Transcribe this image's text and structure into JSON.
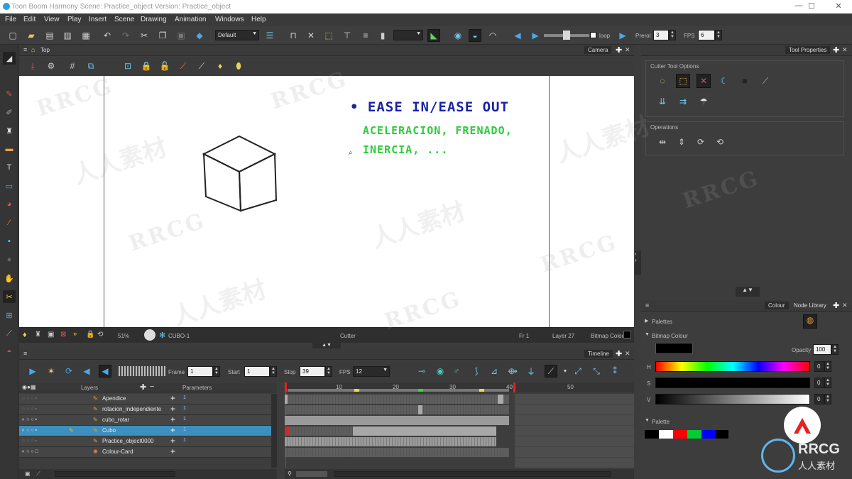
{
  "window": {
    "title": "Toon Boom Harmony Scene: Practice_object Version: Practice_object",
    "minimize": "—",
    "maximize": "☐",
    "close": "✕"
  },
  "menu": [
    "File",
    "Edit",
    "View",
    "Play",
    "Insert",
    "Scene",
    "Drawing",
    "Animation",
    "Windows",
    "Help"
  ],
  "toolbar": {
    "workspace_select": "Default",
    "loop_label": "loop",
    "prerol_label": "Prerol",
    "prerol_value": "3",
    "fps_label": "FPS",
    "fps_value": "6"
  },
  "camera": {
    "breadcrumb": "Top",
    "tab_label": "Camera",
    "drawing_text": {
      "line1": "• EASE IN/EASE OUT",
      "line2": "ACELERACION, FRENADO,",
      "line3": "INERCIA, ..."
    },
    "status": {
      "zoom": "51%",
      "drawing_name": "CUBO-1",
      "tool_name": "Cutter",
      "frame_label": "Fr 1",
      "position_label": "Layer 27",
      "colour_label": "Bitmap Colour"
    }
  },
  "tool_properties": {
    "tab_label": "Tool Properties",
    "group1": "Cutter Tool Options",
    "group2": "Operations"
  },
  "colour_panel": {
    "tab_colour": "Colour",
    "tab_node_library": "Node Library",
    "palettes_label": "Palettes",
    "bitmap_colour_label": "Bitmap Colour",
    "opacity_label": "Opacity",
    "opacity_value": "100",
    "h_label": "H",
    "s_label": "S",
    "v_label": "V",
    "h_value": "0",
    "s_value": "0",
    "v_value": "0",
    "palette_label": "Palette",
    "swatches": [
      "#000000",
      "#ffffff",
      "#ff0000",
      "#00cc33",
      "#0000ff",
      "#000000"
    ]
  },
  "timeline": {
    "tab_label": "Timeline",
    "frame_label": "Frame",
    "frame_value": "1",
    "start_label": "Start",
    "start_value": "1",
    "stop_label": "Stop",
    "stop_value": "39",
    "fps_label": "FPS",
    "fps_value": "12",
    "layers_header": "Layers",
    "parameters_header": "Parameters",
    "ruler": [
      "10",
      "20",
      "30",
      "40",
      "50"
    ],
    "layers": [
      {
        "name": "Apendice",
        "param": "1"
      },
      {
        "name": "rotacion_independiente",
        "param": "1"
      },
      {
        "name": "cubo_rotar",
        "param": "1"
      },
      {
        "name": "Cubo",
        "param": "1"
      },
      {
        "name": "Practice_object0000",
        "param": "1"
      },
      {
        "name": "Colour-Card",
        "param": ""
      }
    ]
  },
  "watermarks": {
    "brand": "RRCG",
    "cn": "人人素材"
  }
}
